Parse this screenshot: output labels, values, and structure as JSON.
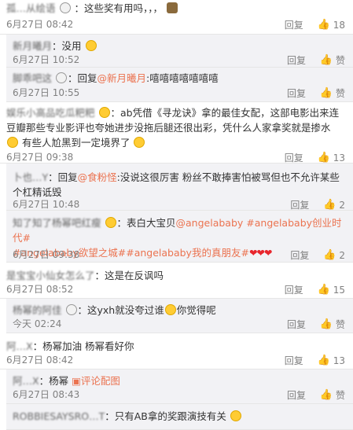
{
  "colors": {
    "accent": "#eb7350",
    "text": "#333333",
    "meta": "#808080",
    "subbg": "#f2f2f5",
    "heart": "#e8262d"
  },
  "comments": [
    {
      "user": "孤…从绘语",
      "text": "：这些奖有用吗，，，",
      "time": "6月27日 08:42",
      "reply": "回复",
      "likes": "18"
    },
    {
      "user": "新月曦月",
      "text": "：没用",
      "time": "6月27日 10:52",
      "reply": "回复",
      "likes": "赞"
    },
    {
      "user": "脚乖吧这",
      "text_a": "：回复",
      "mention": "@新月曦月",
      "text_b": ":嘻嘻嘻嘻嘻嘻嘻",
      "time": "6月27日 10:55",
      "reply": "回复",
      "likes": "赞"
    },
    {
      "user": "娱乐小高品吃瓜粑粑",
      "text": "：ab凭借《寻龙诀》拿的最佳女配，这部电影出来连豆瓣那些专业影评也夸她进步没拖后腿还很出彩，凭什么人家拿奖就是掺水",
      "text2": "有些人尬黑到一定境界了",
      "time": "6月27日 09:38",
      "reply": "回复",
      "likes": "13"
    },
    {
      "user": "卜也…Y",
      "text": "：回复",
      "mention": "@食粉怪",
      "text_b": ":没说这很厉害   粉丝不敢捧害怕被骂但也不允许某些个杠精诋毁",
      "time": "6月27日 10:48",
      "reply": "回复",
      "likes": "2"
    },
    {
      "user": "知了知了杨幂吧红瘦",
      "text": "：表白大宝贝",
      "tag1": "@angelababy",
      "tag2": "#angelababy创业时代#",
      "tag3": "#angelababy欲望之城#",
      "tag4": "#angelababy我的真朋友#",
      "hearts": "❤❤❤",
      "time": "6月27日 09:38",
      "reply": "回复",
      "likes": "2"
    },
    {
      "user": "是宝宝小仙女怎么了",
      "text": "：这是在反讽吗",
      "time": "6月27日 08:52",
      "reply": "回复",
      "likes": "15"
    },
    {
      "user": "杨幂的阿佳",
      "text": "：这yxh就没夸过谁",
      "text2": "你觉得呢",
      "time": "今天 02:24",
      "reply": "回复",
      "likes": "赞"
    },
    {
      "user": "阿…X",
      "text": "：杨幂加油 杨幂看好你",
      "time": "6月27日 08:42",
      "reply": "回复",
      "likes": "13"
    },
    {
      "user": "阿…X",
      "text": "：杨幂",
      "comment_pic": "评论配图",
      "time": "6月27日 08:43",
      "reply": "回复",
      "likes": "赞"
    },
    {
      "user": "ROBBIESAYSRO…T",
      "text": "：只有AB拿的奖跟演技有关"
    }
  ]
}
